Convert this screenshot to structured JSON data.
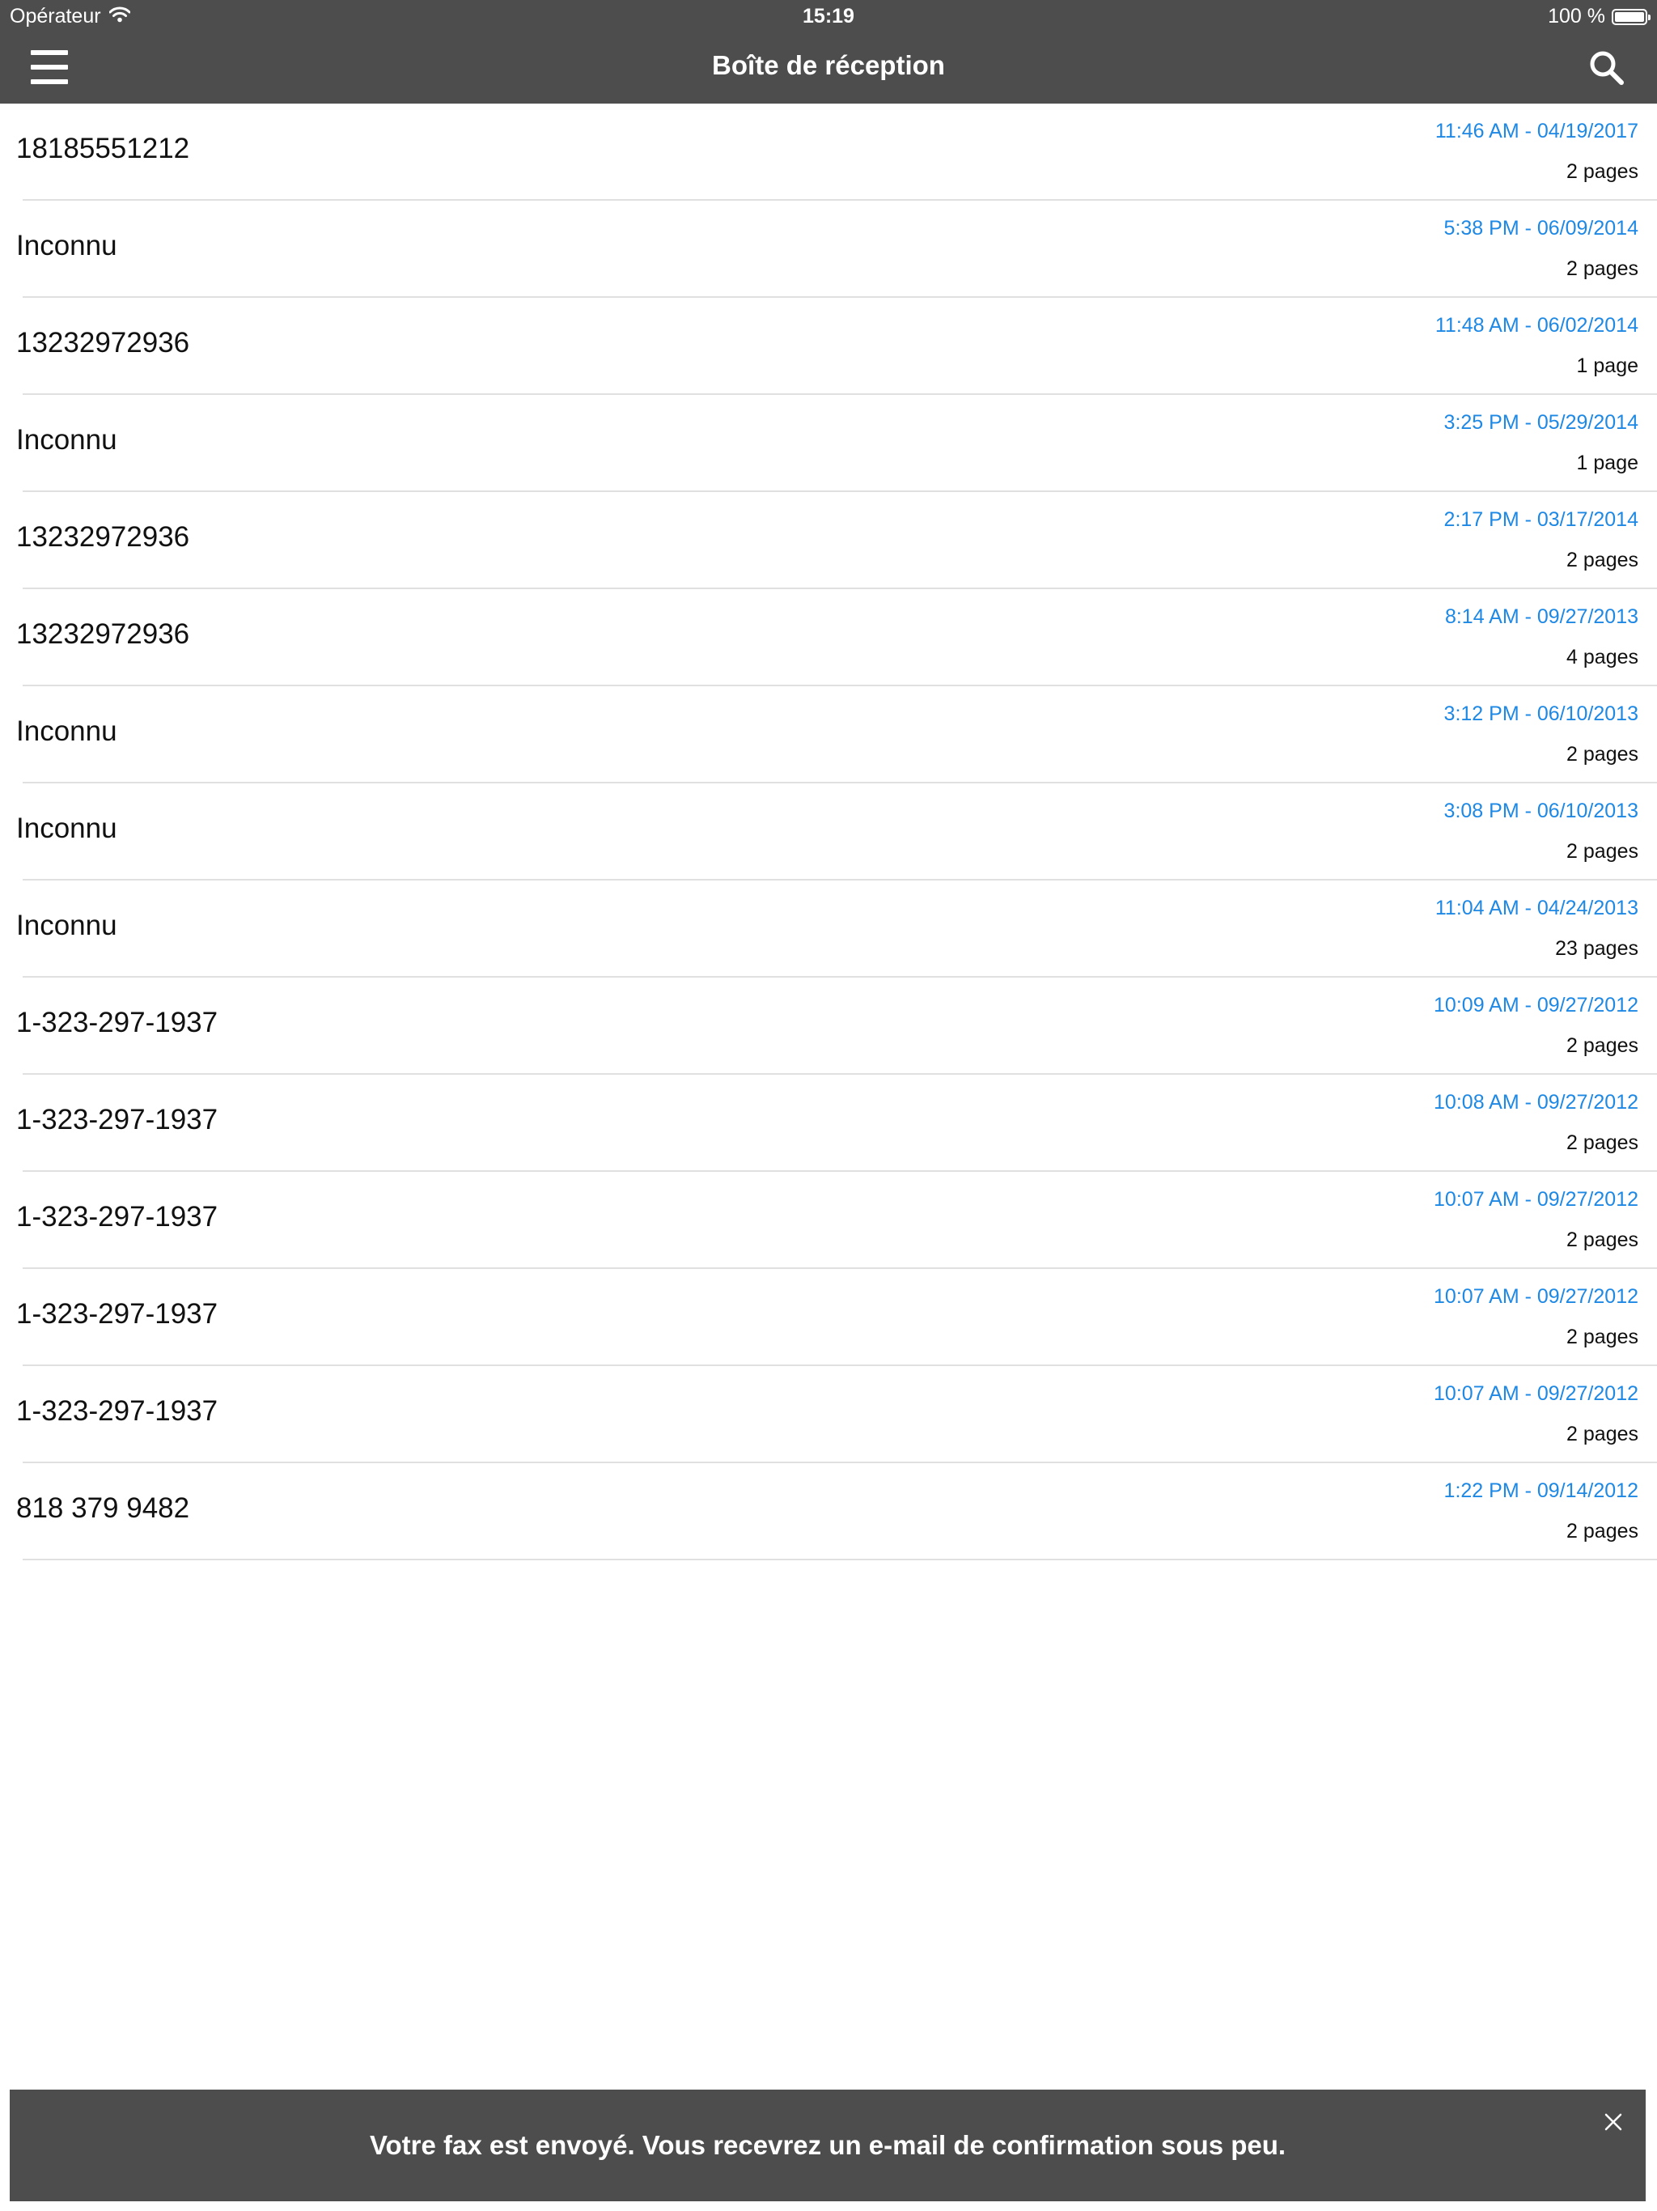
{
  "status_bar": {
    "carrier": "Opérateur",
    "time": "15:19",
    "battery": "100 %"
  },
  "navbar": {
    "title": "Boîte de réception",
    "menu_icon": "hamburger-menu-icon",
    "search_icon": "search-icon"
  },
  "faxes": [
    {
      "sender": "18185551212",
      "date": "11:46 AM - 04/19/2017",
      "pages": "2 pages"
    },
    {
      "sender": "Inconnu",
      "date": "5:38 PM - 06/09/2014",
      "pages": "2 pages"
    },
    {
      "sender": "13232972936",
      "date": "11:48 AM - 06/02/2014",
      "pages": "1 page"
    },
    {
      "sender": "Inconnu",
      "date": "3:25 PM - 05/29/2014",
      "pages": "1 page"
    },
    {
      "sender": "13232972936",
      "date": "2:17 PM - 03/17/2014",
      "pages": "2 pages"
    },
    {
      "sender": "13232972936",
      "date": "8:14 AM - 09/27/2013",
      "pages": "4 pages"
    },
    {
      "sender": "Inconnu",
      "date": "3:12 PM - 06/10/2013",
      "pages": "2 pages"
    },
    {
      "sender": "Inconnu",
      "date": "3:08 PM - 06/10/2013",
      "pages": "2 pages"
    },
    {
      "sender": "Inconnu",
      "date": "11:04 AM - 04/24/2013",
      "pages": "23 pages"
    },
    {
      "sender": "1-323-297-1937",
      "date": "10:09 AM - 09/27/2012",
      "pages": "2 pages"
    },
    {
      "sender": "1-323-297-1937",
      "date": "10:08 AM - 09/27/2012",
      "pages": "2 pages"
    },
    {
      "sender": "1-323-297-1937",
      "date": "10:07 AM - 09/27/2012",
      "pages": "2 pages"
    },
    {
      "sender": "1-323-297-1937",
      "date": "10:07 AM - 09/27/2012",
      "pages": "2 pages"
    },
    {
      "sender": "1-323-297-1937",
      "date": "10:07 AM - 09/27/2012",
      "pages": "2 pages"
    },
    {
      "sender": "818 379 9482",
      "date": "1:22 PM - 09/14/2012",
      "pages": "2 pages"
    }
  ],
  "toast": {
    "message": "Votre fax est envoyé. Vous recevrez un e-mail de confirmation sous peu.",
    "close_icon": "close-icon"
  },
  "colors": {
    "bar_background": "#4d4d4d",
    "date_accent": "#1e88e5",
    "separator": "#e0e0e0"
  }
}
